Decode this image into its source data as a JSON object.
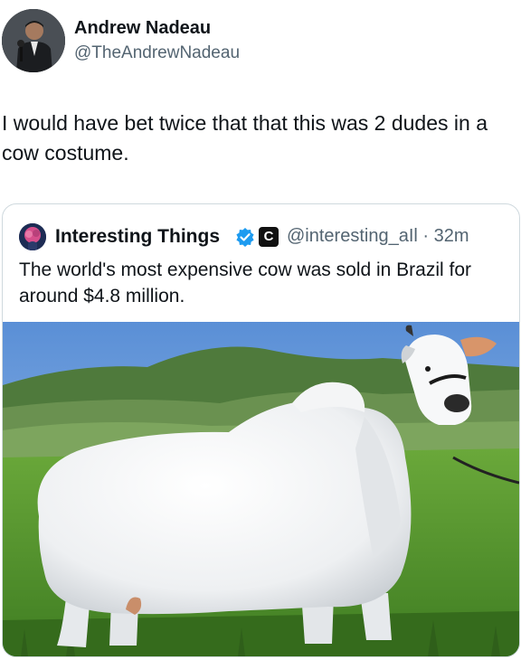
{
  "post": {
    "author_name": "Andrew Nadeau",
    "author_handle": "@TheAndrewNadeau",
    "text": "I would have bet twice that that this was 2 dudes in a cow costume."
  },
  "quoted_post": {
    "author_name": "Interesting Things",
    "affiliate_badge": "C",
    "meta": "@interesting_aIl · 32m",
    "text": "The world's most expensive cow was sold in Brazil for around $4.8 million.",
    "verified_color": "#1d9bf0"
  },
  "media": {
    "subject": "white-nelore-cow-in-pasture"
  },
  "colors": {
    "text": "#0f1419",
    "secondary": "#536471",
    "border": "#cfd9de"
  }
}
